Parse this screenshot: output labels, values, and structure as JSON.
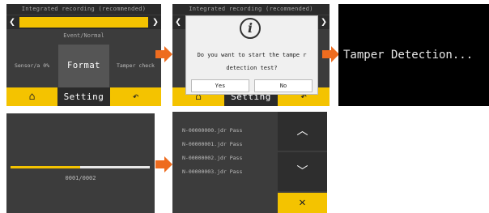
{
  "screen1": {
    "header": "Integrated recording (recommended)",
    "nav_left": "❮",
    "nav_right": "❯",
    "subheader": "Event/Normal",
    "buttons": [
      "Sensor/a 0%",
      "Format",
      "Tamper check"
    ],
    "bottom": {
      "home": "⌂",
      "setting": "Setting",
      "back": "↶"
    }
  },
  "screen2": {
    "header": "Integrated recording (recommended)",
    "nav_left": "❮",
    "nav_right": "❯",
    "dialog": {
      "icon": "i",
      "message": "Do you want to start the tampe r detection test?",
      "yes": "Yes",
      "no": "No"
    },
    "bottom": {
      "home": "⌂",
      "setting": "Setting",
      "back": "↶"
    }
  },
  "screen3": {
    "text": "Tamper Detection..."
  },
  "screen4": {
    "progress_fraction": 0.5,
    "progress_text": "0001/0002"
  },
  "screen5": {
    "items": [
      "N-00000000.jdr Pass",
      "N-00000001.jdr Pass",
      "N-00000002.jdr Pass",
      "N-00000003.jdr Pass"
    ],
    "up": "︿",
    "down": "﹀",
    "close": "✕"
  },
  "colors": {
    "accent": "#f4c300",
    "panel": "#3c3c3c",
    "dark": "#2b2b2b",
    "arrow": "#ee6c1f"
  }
}
